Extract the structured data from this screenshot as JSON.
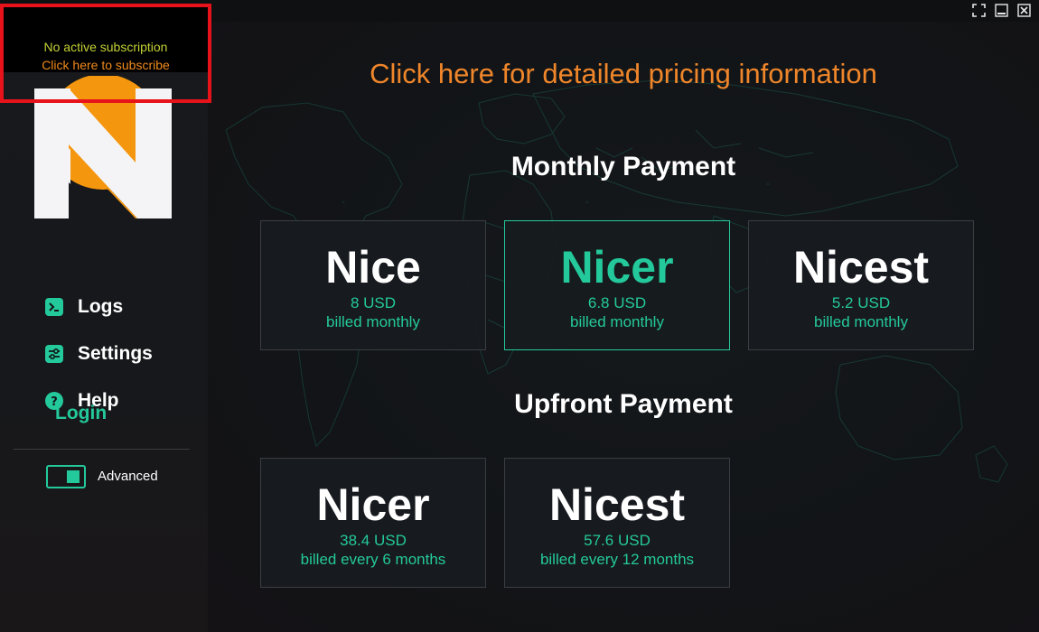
{
  "window_controls": {
    "maximize_icon": "fullscreen-icon",
    "minimize_icon": "minimize-icon",
    "close_icon": "close-icon"
  },
  "subscription": {
    "status": "No active subscription",
    "cta": "Click here to subscribe"
  },
  "sidebar": {
    "items": [
      {
        "label": "Logs",
        "icon": "terminal-icon"
      },
      {
        "label": "Settings",
        "icon": "sliders-icon"
      },
      {
        "label": "Help",
        "icon": "question-icon"
      }
    ],
    "login_label": "Login",
    "advanced_label": "Advanced",
    "advanced_enabled": true
  },
  "main": {
    "pricing_link": "Click here for detailed pricing information",
    "monthly": {
      "title": "Monthly Payment",
      "plans": [
        {
          "name": "Nice",
          "price": "8 USD",
          "billing": "billed monthly",
          "selected": false
        },
        {
          "name": "Nicer",
          "price": "6.8 USD",
          "billing": "billed monthly",
          "selected": true
        },
        {
          "name": "Nicest",
          "price": "5.2 USD",
          "billing": "billed monthly",
          "selected": false
        }
      ]
    },
    "upfront": {
      "title": "Upfront Payment",
      "plans": [
        {
          "name": "Nicer",
          "price": "38.4 USD",
          "billing": "billed every 6 months"
        },
        {
          "name": "Nicest",
          "price": "57.6 USD",
          "billing": "billed every 12 months"
        }
      ]
    }
  },
  "colors": {
    "accent": "#24c99b",
    "orange": "#f0862a",
    "status_yellow": "#c4d236",
    "highlight_red": "#e8121b",
    "background": "#121417"
  }
}
